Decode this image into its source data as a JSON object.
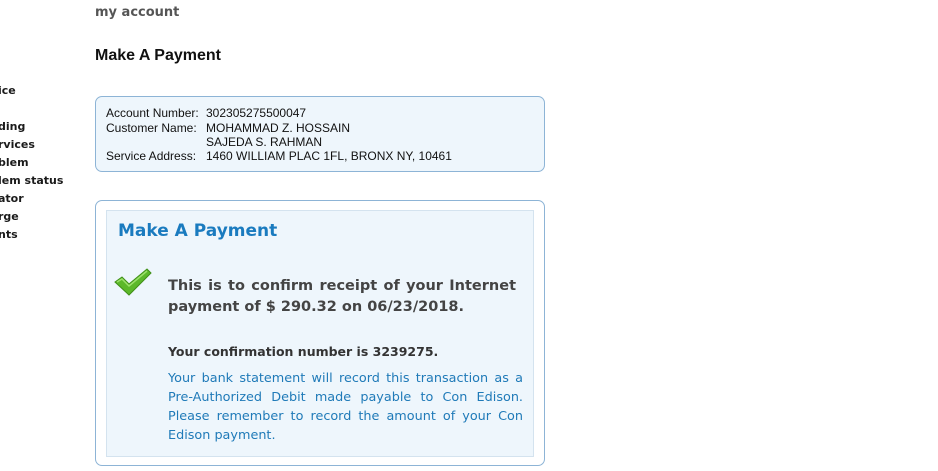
{
  "header": {
    "account_label": "my account"
  },
  "left_nav": {
    "items": [
      {
        "label": "ice"
      },
      {
        "label": "ding"
      },
      {
        "label": "rvices"
      },
      {
        "label": "blem"
      },
      {
        "label": "lem status"
      },
      {
        "label": "ator"
      },
      {
        "label": "rge"
      },
      {
        "label": "nts"
      }
    ]
  },
  "page": {
    "title": "Make A Payment"
  },
  "account": {
    "number_label": "Account Number:",
    "number": "302305275500047",
    "customer_label": "Customer Name:",
    "customer_names": [
      "MOHAMMAD Z. HOSSAIN",
      "SAJEDA S. RAHMAN"
    ],
    "address_label": "Service Address:",
    "address": "1460 WILLIAM PLAC 1FL, BRONX NY, 10461"
  },
  "payment": {
    "title": "Make A Payment",
    "check_icon": "check-icon",
    "confirm_text": "This is to confirm receipt of your Internet payment of $ 290.32 on 06/23/2018.",
    "confirmation_number_text": "Your confirmation number is 3239275.",
    "bank_note": "Your bank statement will record this transaction as a Pre-Authorized Debit made payable to Con Edison. Please remember to record the amount of your Con Edison payment.",
    "accent_color": "#1a7bbf",
    "check_color": "#5cb82a"
  }
}
